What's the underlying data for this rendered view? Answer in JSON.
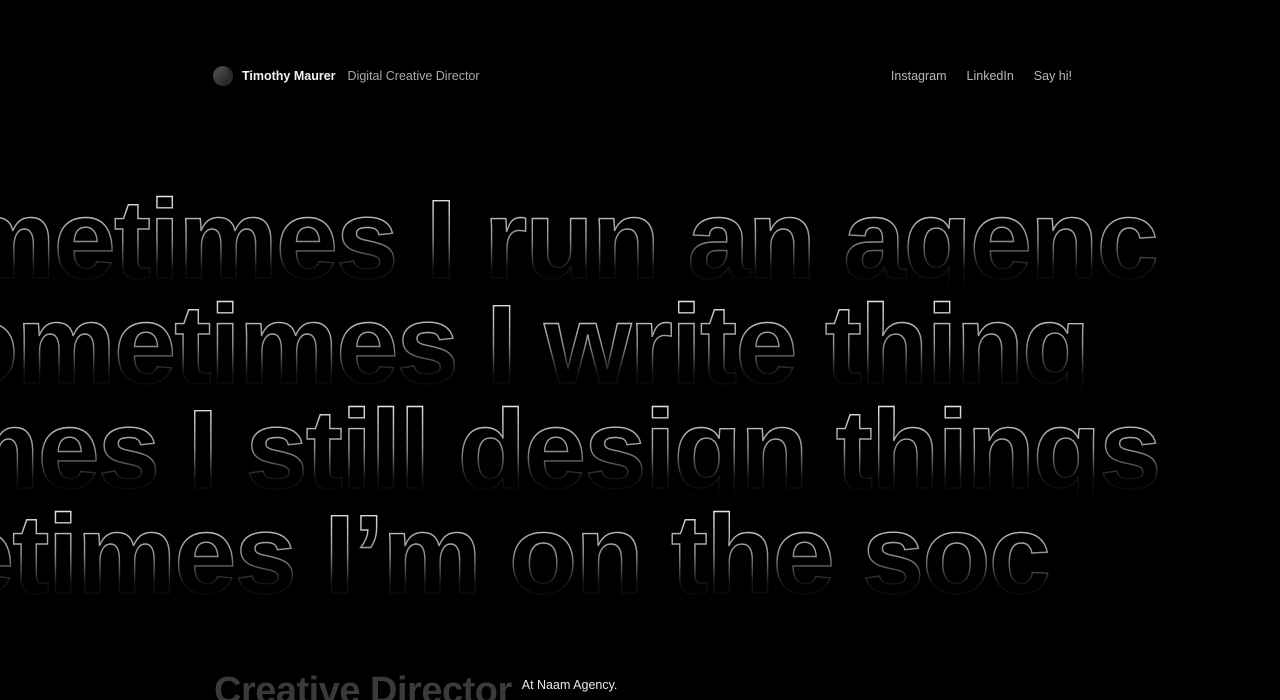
{
  "header": {
    "name": "Timothy Maurer",
    "role": "Digital Creative Director",
    "logo_icon": "half-moon-logo-icon"
  },
  "nav": {
    "items": [
      {
        "label": "Instagram"
      },
      {
        "label": "LinkedIn"
      },
      {
        "label": "Say hi!"
      }
    ]
  },
  "marquee": {
    "lines": [
      "metimes I run an agenc",
      "ometimes I write thing",
      "mes I still design things",
      "etimes I’m on the soc"
    ],
    "stroke_color": "#ffffff",
    "fill_color": "#000000"
  },
  "bottom": {
    "title": "Creative Director",
    "subtitle": "At Naam Agency."
  }
}
